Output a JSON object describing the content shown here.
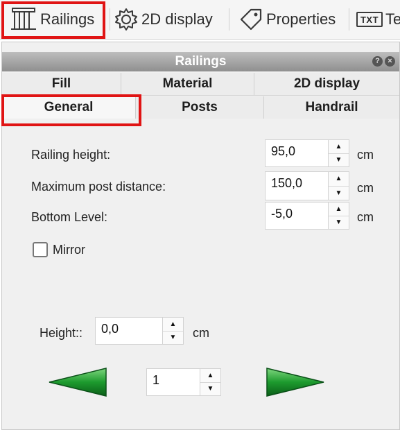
{
  "toolbar": {
    "items": [
      {
        "label": "Railings",
        "icon": "railing-icon"
      },
      {
        "label": "2D display",
        "icon": "gear-icon"
      },
      {
        "label": "Properties",
        "icon": "tag-icon"
      },
      {
        "label": "Te",
        "icon_text": "TXT"
      }
    ]
  },
  "panel": {
    "title": "Railings",
    "tabs_row1": [
      "Fill",
      "Material",
      "2D display"
    ],
    "tabs_row2": [
      "General",
      "Posts",
      "Handrail"
    ],
    "fields": [
      {
        "label": "Railing height:",
        "value": "95,0",
        "unit": "cm"
      },
      {
        "label": "Maximum post distance:",
        "value": "150,0",
        "unit": "cm"
      },
      {
        "label": "Bottom Level:",
        "value": "-5,0",
        "unit": "cm"
      }
    ],
    "mirror_label": "Mirror",
    "height_label": "Height::",
    "height_value": "0,0",
    "height_unit": "cm",
    "page_value": "1"
  },
  "colors": {
    "highlight": "#e01414",
    "arrow_green": "#1d9a2e"
  }
}
